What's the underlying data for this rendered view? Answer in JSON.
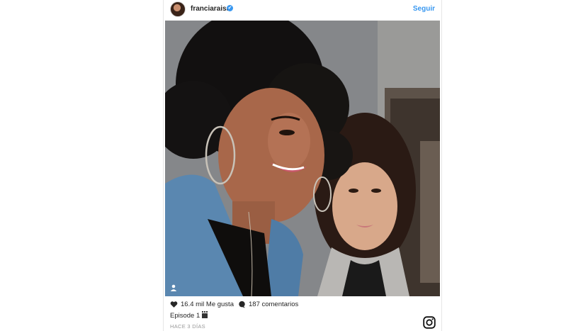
{
  "post": {
    "username": "franciaraisa",
    "verified_mark": "✔",
    "follow_label": "Seguir",
    "likes": "16.4 mil Me gusta",
    "comments": "187 comentarios",
    "caption": "Episode 1",
    "caption_emoji": "clapperboard-icon",
    "time": "HACE 3 DÍAS"
  },
  "icons": {
    "heart": "heart-icon",
    "comment": "comment-bubble-icon",
    "user_tag": "user-tag-icon",
    "brand": "instagram-icon"
  },
  "colors": {
    "link": "#3897f0",
    "text": "#262626",
    "muted": "#999999"
  }
}
